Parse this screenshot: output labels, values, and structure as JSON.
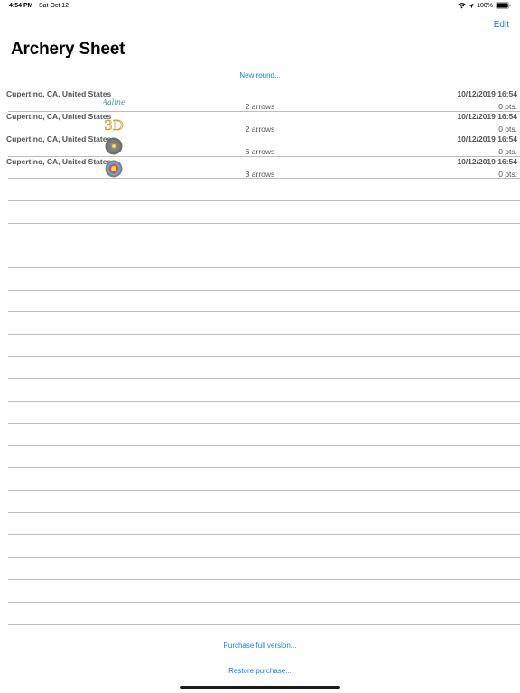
{
  "status_bar": {
    "time": "4:54 PM",
    "date": "Sat Oct 12",
    "battery": "100%",
    "icons": [
      "wifi-icon",
      "location-arrow-icon",
      "battery-icon"
    ]
  },
  "nav": {
    "edit_label": "Edit",
    "title": "Archery Sheet",
    "new_round_label": "New round..."
  },
  "rounds": [
    {
      "location": "Cupertino, CA, United States",
      "date": "10/12/2019 16:54",
      "arrows": "2 arrows",
      "points": "0 pts.",
      "icon": "script-logo-icon",
      "icon_text": "Aaline"
    },
    {
      "location": "Cupertino, CA, United States",
      "date": "10/12/2019 16:54",
      "arrows": "2 arrows",
      "points": "0 pts.",
      "icon": "3d-target-icon",
      "icon_text": "3D"
    },
    {
      "location": "Cupertino, CA, United States",
      "date": "10/12/2019 16:54",
      "arrows": "6 arrows",
      "points": "0 pts.",
      "icon": "gray-target-face-icon"
    },
    {
      "location": "Cupertino, CA, United States",
      "date": "10/12/2019 16:54",
      "arrows": "3 arrows",
      "points": "0 pts.",
      "icon": "target-face-icon"
    }
  ],
  "footer": {
    "purchase_label": "Purchase full version...",
    "restore_label": "Restore purchase..."
  },
  "colors": {
    "accent": "#1a7ef2",
    "secondary_text": "#555555",
    "separator": "#bdbdbd"
  }
}
